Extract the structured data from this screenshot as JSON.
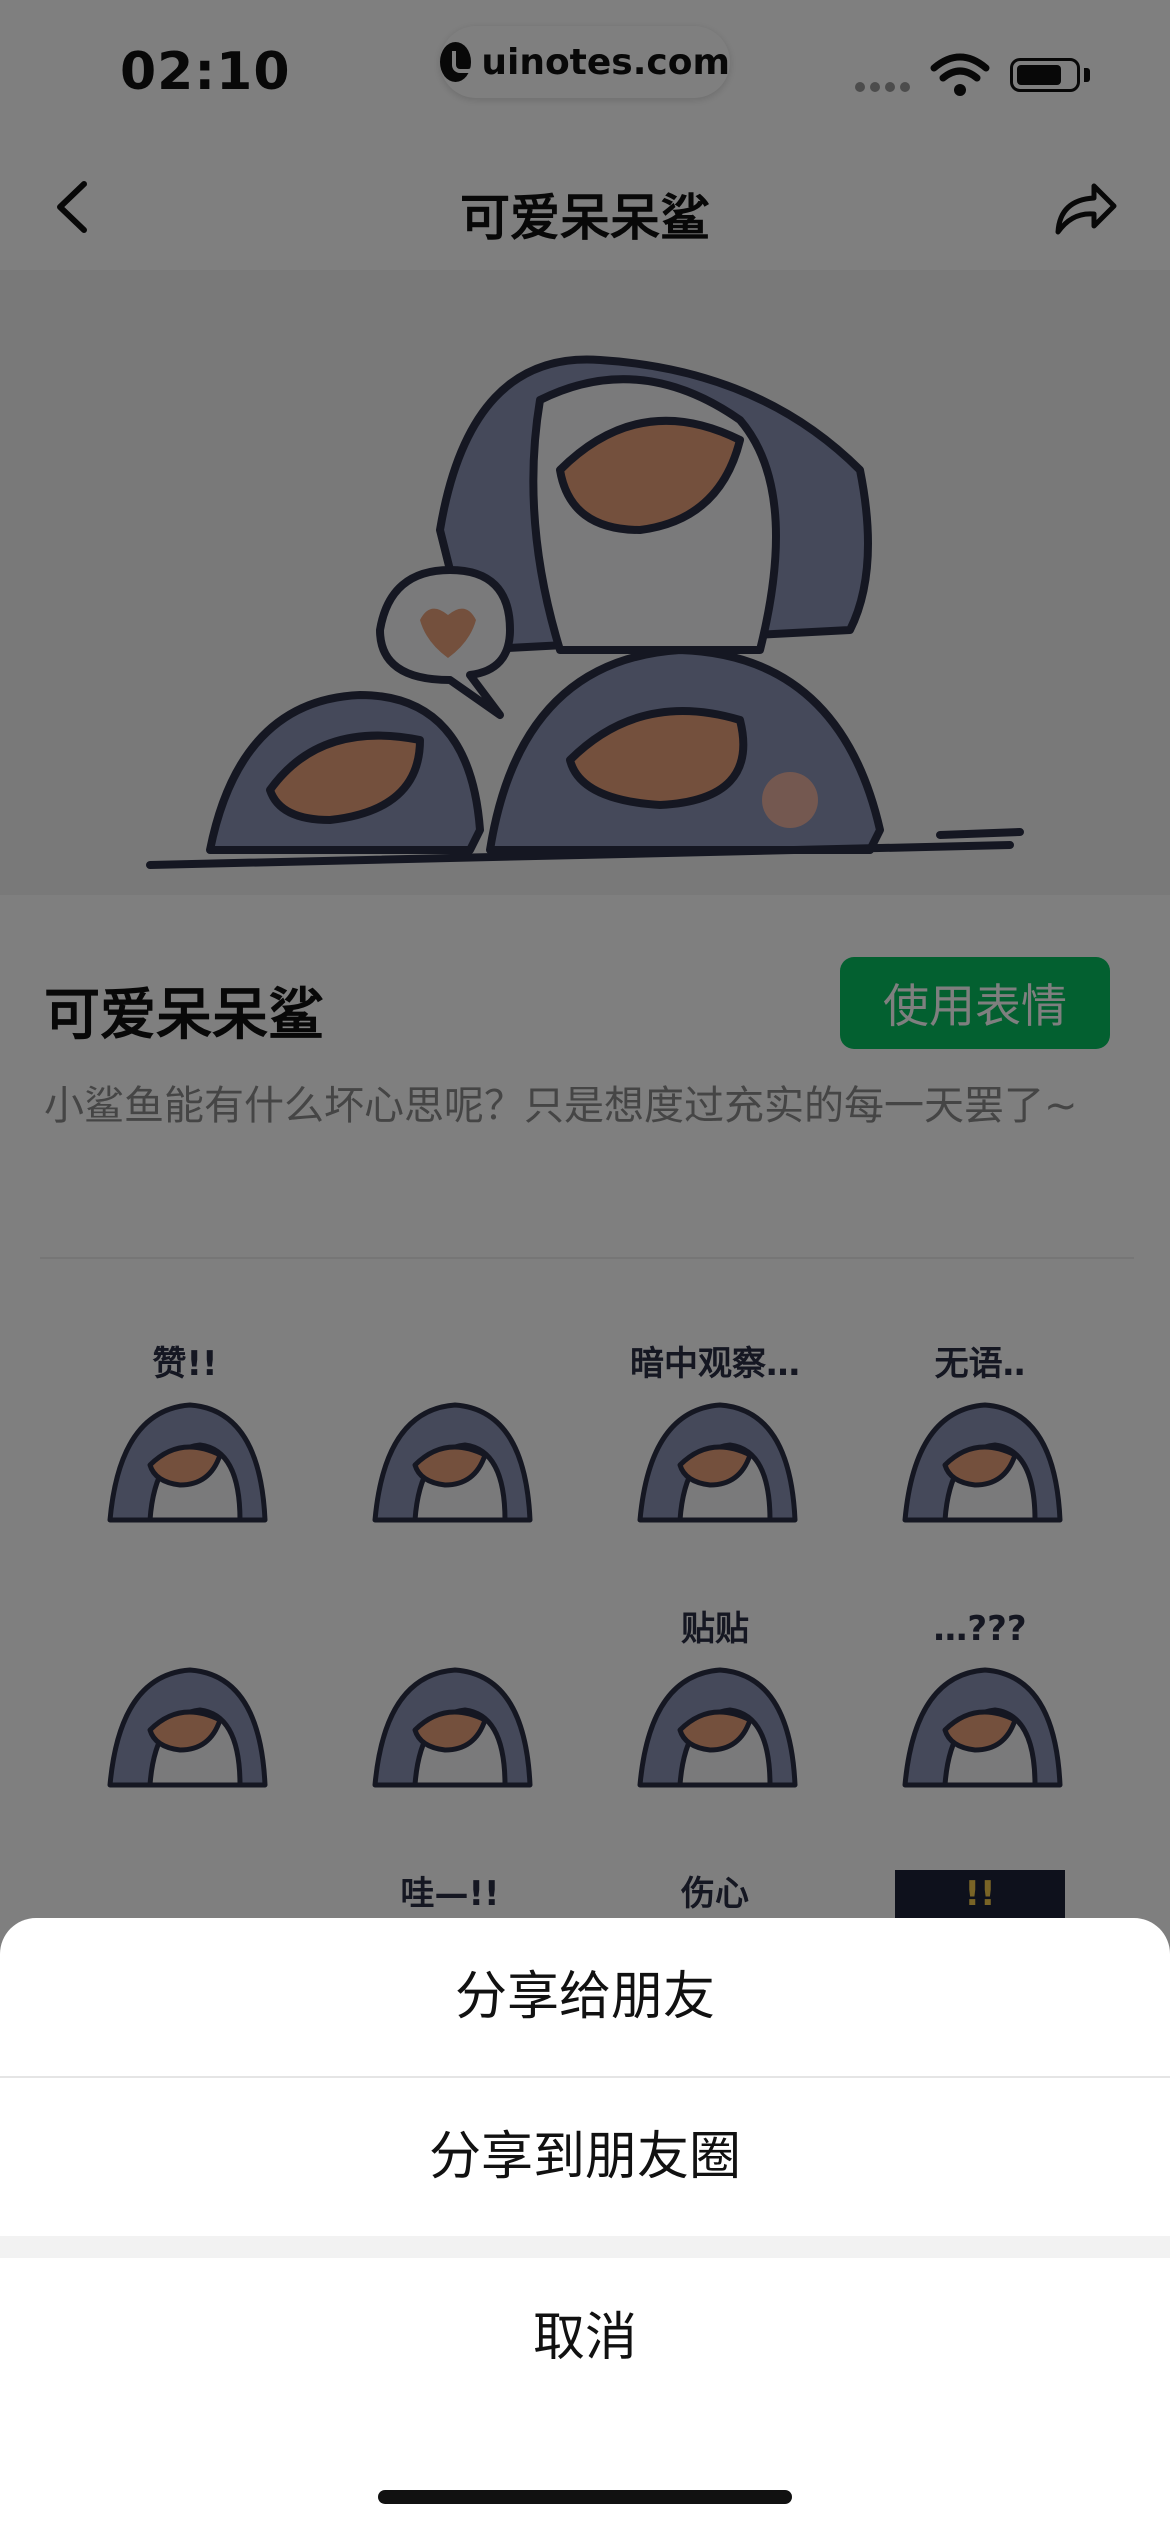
{
  "status_bar": {
    "time": "02:10",
    "site": "uinotes.com"
  },
  "nav": {
    "title": "可爱呆呆鲨"
  },
  "pack": {
    "title": "可爱呆呆鲨",
    "use_button": "使用表情",
    "description": "小鲨鱼能有什么坏心思呢？只是想度过充实的每一天罢了~"
  },
  "stickers": [
    {
      "name": "sticker-zan",
      "caption": "赞!!"
    },
    {
      "name": "sticker-watermelon",
      "caption": ""
    },
    {
      "name": "sticker-observe",
      "caption": "暗中观察…"
    },
    {
      "name": "sticker-speechless",
      "caption": "无语‥"
    },
    {
      "name": "sticker-heart",
      "caption": ""
    },
    {
      "name": "sticker-angry",
      "caption": ""
    },
    {
      "name": "sticker-tietie",
      "caption": "贴贴"
    },
    {
      "name": "sticker-phone",
      "caption": "…???"
    },
    {
      "name": "sticker-swish",
      "caption": ""
    },
    {
      "name": "sticker-wa",
      "caption": "哇—!!"
    },
    {
      "name": "sticker-sad",
      "caption": "伤心"
    },
    {
      "name": "sticker-night",
      "caption": "!!"
    }
  ],
  "action_sheet": {
    "share_friend": "分享给朋友",
    "share_moments": "分享到朋友圈",
    "cancel": "取消"
  },
  "colors": {
    "accent": "#07c160",
    "shark": "#8a93b5",
    "outline": "#2b2f45"
  },
  "icons": [
    "back-chevron-icon",
    "share-arrow-icon",
    "wifi-icon",
    "battery-icon"
  ]
}
